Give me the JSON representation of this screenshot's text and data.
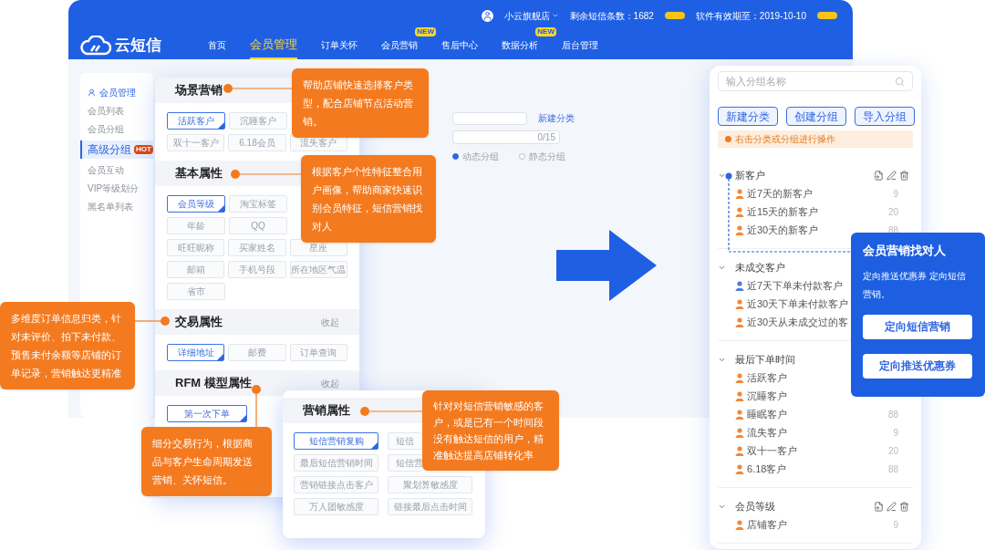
{
  "header": {
    "logo_text": "云短信",
    "nav": [
      {
        "label": "首页",
        "selected": false
      },
      {
        "label": "会员管理",
        "selected": true
      },
      {
        "label": "订单关怀",
        "selected": false
      },
      {
        "label": "会员营销",
        "selected": false,
        "badge": "NEW"
      },
      {
        "label": "售后中心",
        "selected": false
      },
      {
        "label": "数据分析",
        "selected": false,
        "badge": "NEW"
      },
      {
        "label": "后台管理",
        "selected": false
      }
    ],
    "shop": "小云旗舰店",
    "sms_remaining": "剩余短信条数：1682",
    "expiry": "软件有效期至：2019-10-10"
  },
  "sidebar": {
    "title": "会员管理",
    "items": [
      {
        "label": "会员列表",
        "selected": false
      },
      {
        "label": "会员分组",
        "selected": false
      },
      {
        "label": "高级分组",
        "selected": true,
        "badge": "HOT"
      },
      {
        "label": "会员互动",
        "selected": false
      },
      {
        "label": "VIP等级划分",
        "selected": false
      },
      {
        "label": "黑名单列表",
        "selected": false
      }
    ]
  },
  "background_form": {
    "link": "新建分类",
    "counter": "0/15",
    "radios": [
      {
        "label": "动态分组",
        "selected": true
      },
      {
        "label": "静态分组",
        "selected": false
      }
    ]
  },
  "attribute_card": {
    "sections": [
      {
        "title": "场景营销",
        "rows": [
          [
            {
              "label": "活跃客户",
              "selected": true
            },
            {
              "label": "沉睡客户",
              "selected": false
            }
          ],
          [
            {
              "label": "双十一客户",
              "selected": false
            },
            {
              "label": "6.18会员",
              "selected": false
            },
            {
              "label": "流失客户",
              "selected": false
            }
          ]
        ]
      },
      {
        "title": "基本属性",
        "rows": [
          [
            {
              "label": "会员等级",
              "selected": true
            },
            {
              "label": "淘宝标签",
              "selected": false
            }
          ],
          [
            {
              "label": "年龄",
              "selected": false
            },
            {
              "label": "QQ",
              "selected": false
            }
          ],
          [
            {
              "label": "旺旺昵称",
              "selected": false
            },
            {
              "label": "买家姓名",
              "selected": false
            },
            {
              "label": "星座",
              "selected": false
            }
          ],
          [
            {
              "label": "邮箱",
              "selected": false
            },
            {
              "label": "手机号段",
              "selected": false
            },
            {
              "label": "所在地区气温",
              "selected": false
            }
          ],
          [
            {
              "label": "省市",
              "selected": false
            }
          ]
        ]
      },
      {
        "title": "交易属性",
        "action": "收起",
        "rows": [
          [
            {
              "label": "详细地址",
              "selected": true
            },
            {
              "label": "邮费",
              "selected": false
            },
            {
              "label": "订单查询",
              "selected": false
            }
          ]
        ]
      },
      {
        "title": "RFM 模型属性",
        "action": "收起",
        "rows": [
          [
            {
              "label": "第一次下单",
              "selected": true
            }
          ]
        ]
      }
    ]
  },
  "marketing_card": {
    "title": "营销属性",
    "rows": [
      [
        {
          "label": "短信营销复购",
          "selected": true
        },
        {
          "label": "短信",
          "selected": false
        }
      ],
      [
        {
          "label": "最后短信营销时间",
          "selected": false
        },
        {
          "label": "短信营",
          "selected": false
        }
      ],
      [
        {
          "label": "营销链接点击客户",
          "selected": false
        },
        {
          "label": "聚划算敏感度",
          "selected": false
        }
      ],
      [
        {
          "label": "万人团敏感度",
          "selected": false
        },
        {
          "label": "链接最后点击时间",
          "selected": false
        }
      ]
    ]
  },
  "callouts": [
    "帮助店铺快速选择客户类型，配合店铺节点活动营销。",
    "根据客户个性特征整合用户画像，帮助商家快速识别会员特征，短信营销找对人",
    "多维度订单信息归类，针对未评价、拍下未付款、预售未付余额等店铺的订单记录，营销触达更精准",
    "细分交易行为，根据商品与客户生命周期发送营销、关怀短信。",
    "针对对短信营销敏感的客户，或是已有一个时间段没有触达短信的用户，精准触达提高店铺转化率"
  ],
  "group_panel": {
    "search": {
      "placeholder": "输入分组名称"
    },
    "buttons": [
      "新建分类",
      "创建分组",
      "导入分组"
    ],
    "notice": "右击分类或分组进行操作",
    "groups": [
      {
        "title": "新客户",
        "actions": true,
        "items": [
          {
            "label": "近7天的新客户",
            "count": "9",
            "color": "#f0883a"
          },
          {
            "label": "近15天的新客户",
            "count": "20",
            "color": "#f0883a"
          },
          {
            "label": "近30天的新客户",
            "count": "88",
            "color": "#f0883a"
          }
        ]
      },
      {
        "title": "未成交客户",
        "items": [
          {
            "label": "近7天下单未付款客户",
            "color": "#4a7be0"
          },
          {
            "label": "近30天下单未付款客户",
            "color": "#f0883a"
          },
          {
            "label": "近30天从未成交过的客",
            "color": "#f0883a"
          }
        ]
      },
      {
        "title": "最后下单时间",
        "items": [
          {
            "label": "活跃客户",
            "color": "#f0883a"
          },
          {
            "label": "沉睡客户",
            "color": "#f0883a"
          },
          {
            "label": "睡眠客户",
            "count": "88",
            "color": "#f0883a"
          },
          {
            "label": "流失客户",
            "count": "9",
            "color": "#f0883a"
          },
          {
            "label": "双十一客户",
            "count": "20",
            "color": "#f0883a"
          },
          {
            "label": "6.18客户",
            "count": "88",
            "color": "#f0883a"
          }
        ]
      },
      {
        "title": "会员等级",
        "actions": true,
        "items": [
          {
            "label": "店铺客户",
            "count": "9",
            "color": "#f0883a"
          }
        ]
      }
    ]
  },
  "tooltip": {
    "title": "会员营销找对人",
    "text": "定向推送优惠券 定向短信营销。",
    "buttons": [
      "定向短信营销",
      "定向推送优惠券"
    ]
  }
}
